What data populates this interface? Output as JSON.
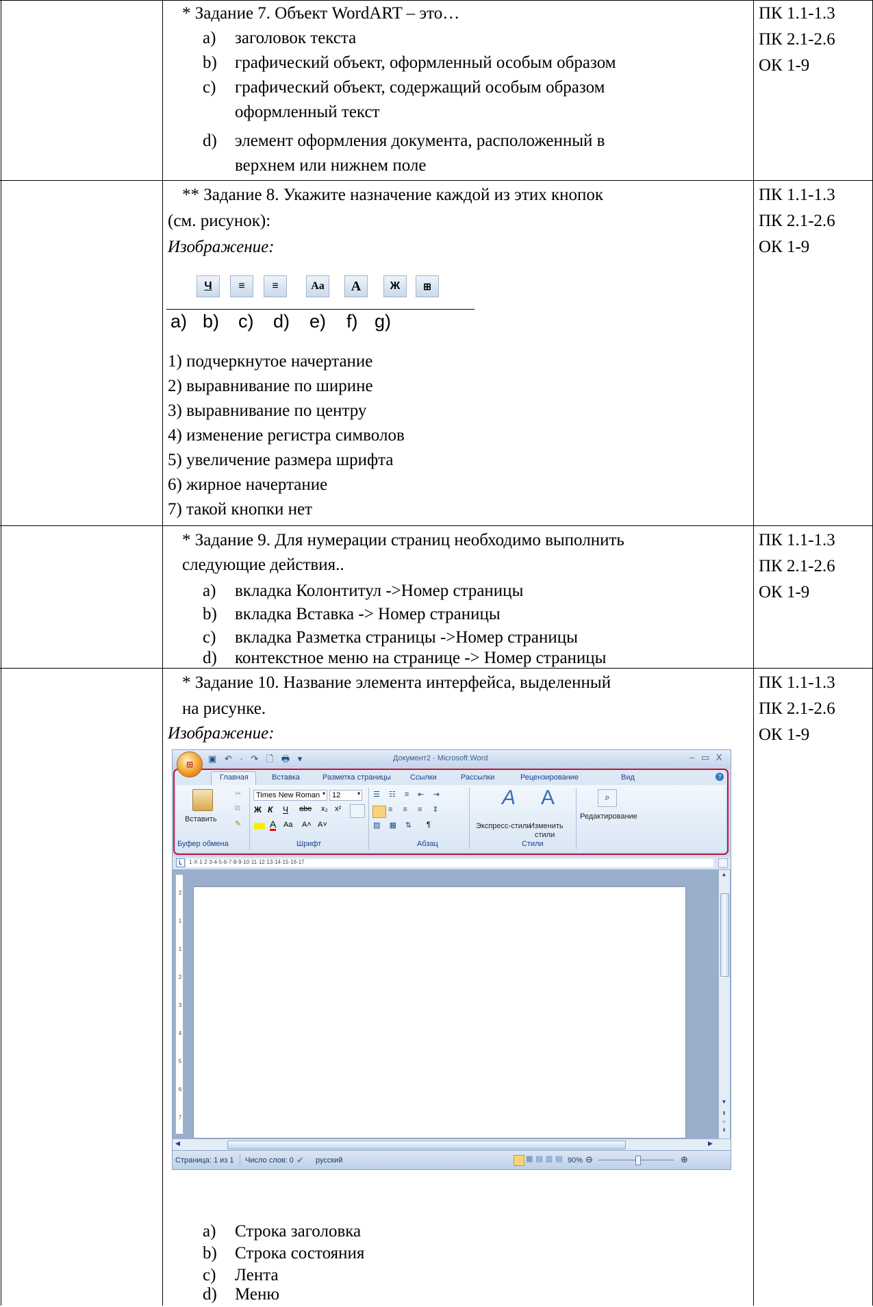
{
  "tasks": [
    {
      "question": "* Задание 7. Объект WordART – это…",
      "options": [
        {
          "letter": "a)",
          "lines": [
            "заголовок текста"
          ]
        },
        {
          "letter": "b)",
          "lines": [
            "графический объект, оформленный особым образом"
          ]
        },
        {
          "letter": "c)",
          "lines": [
            "графический объект, содержащий особым образом",
            "оформленный текст"
          ]
        },
        {
          "letter": "d)",
          "lines": [
            "элемент оформления документа, расположенный в",
            "верхнем или нижнем поле"
          ]
        }
      ],
      "competencies": [
        "ПК 1.1-1.3",
        "ПК 2.1-2.6",
        "ОК 1-9"
      ]
    },
    {
      "question_lines": [
        "** Задание 8. Укажите назначение каждой из этих кнопок",
        "(см. рисунок):"
      ],
      "image_label": "Изображение:",
      "icon_glyphs": [
        "Ч",
        "≡",
        "≡",
        "Aa",
        "A",
        "Ж",
        "⊞"
      ],
      "icon_letters": [
        "a)",
        "b)",
        "c)",
        "d)",
        "e)",
        "f)",
        "g)"
      ],
      "answers": [
        "1) подчеркнутое начертание",
        "2) выравнивание по ширине",
        "3) выравнивание по центру",
        "4) изменение регистра символов",
        "5) увеличение размера шрифта",
        "6) жирное начертание",
        "7) такой кнопки нет"
      ],
      "competencies": [
        "ПК 1.1-1.3",
        "ПК 2.1-2.6",
        "ОК 1-9"
      ]
    },
    {
      "question_lines": [
        "* Задание 9. Для нумерации страниц необходимо выполнить",
        "следующие действия.."
      ],
      "options": [
        {
          "letter": "a)",
          "lines": [
            "вкладка Колонтитул ->Номер страницы"
          ]
        },
        {
          "letter": "b)",
          "lines": [
            "вкладка Вставка -> Номер страницы"
          ]
        },
        {
          "letter": "c)",
          "lines": [
            "вкладка Разметка страницы ->Номер страницы"
          ]
        },
        {
          "letter": "d)",
          "lines": [
            "контекстное меню на странице -> Номер страницы"
          ]
        }
      ],
      "competencies": [
        "ПК 1.1-1.3",
        "ПК 2.1-2.6",
        "ОК 1-9"
      ]
    },
    {
      "question_lines": [
        "* Задание 10. Название элемента интерфейса, выделенный",
        "на рисунке."
      ],
      "image_label": "Изображение:",
      "options": [
        {
          "letter": "a)",
          "lines": [
            "Строка заголовка"
          ]
        },
        {
          "letter": "b)",
          "lines": [
            "Строка состояния"
          ]
        },
        {
          "letter": "c)",
          "lines": [
            "Лента"
          ]
        },
        {
          "letter": "d)",
          "lines": [
            "Меню"
          ]
        }
      ],
      "competencies": [
        "ПК 1.1-1.3",
        "ПК 2.1-2.6",
        "ОК 1-9"
      ]
    }
  ],
  "word_window": {
    "title": "Документ2 - Microsoft Word",
    "office_button": "office-logo-icon",
    "tabs": [
      "Главная",
      "Вставка",
      "Разметка страницы",
      "Ссылки",
      "Рассылки",
      "Рецензирование",
      "Вид"
    ],
    "font_name": "Times New Roman",
    "font_size": "12",
    "buttons": {
      "paste": "Вставить",
      "express_styles": "Экспресс-стили",
      "change_styles_1": "Изменить",
      "change_styles_2": "стили",
      "editing": "Редактирование"
    },
    "group_labels": [
      "Буфер обмена",
      "Шрифт",
      "Абзац",
      "Стили"
    ],
    "format_glyphs": {
      "bold": "Ж",
      "italic": "К",
      "underline": "Ч",
      "strike": "abe",
      "sub": "x₂",
      "sup": "x²",
      "grow": "A˄",
      "shrink": "A˅",
      "case": "Aa",
      "para": "¶"
    },
    "ruler_marks": [
      "1",
      "1",
      "2",
      "3",
      "4",
      "5",
      "6",
      "7",
      "8",
      "9",
      "10",
      "11",
      "12",
      "13",
      "14",
      "15",
      "16",
      "17"
    ],
    "vruler_marks": [
      "2",
      "1",
      "1",
      "2",
      "3",
      "4",
      "5",
      "6",
      "7"
    ],
    "status": {
      "page": "Страница: 1 из 1",
      "words": "Число слов: 0",
      "lang": "русский",
      "zoom": "90%"
    },
    "window_controls": "– ▭ X",
    "accent": "#c8102e"
  }
}
